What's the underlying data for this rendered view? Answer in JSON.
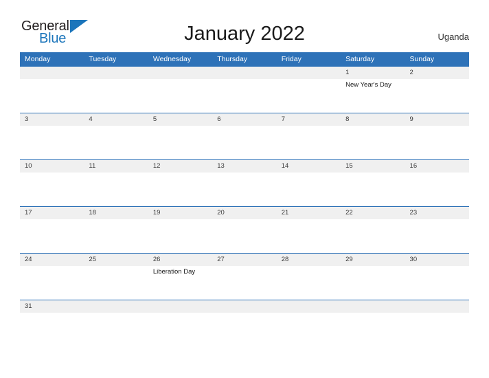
{
  "brand": {
    "word_one": "General",
    "word_two": "Blue"
  },
  "header": {
    "title": "January 2022",
    "locale": "Uganda"
  },
  "calendar": {
    "day_headers": [
      "Monday",
      "Tuesday",
      "Wednesday",
      "Thursday",
      "Friday",
      "Saturday",
      "Sunday"
    ],
    "colors": {
      "header_blue": "#2e72b8",
      "date_strip_gray": "#f0f0f0",
      "divider_blue": "#2e72b8",
      "brand_blue": "#1b75bb",
      "text_dark": "#231f20"
    },
    "weeks": [
      {
        "dates": [
          "",
          "",
          "",
          "",
          "",
          "1",
          "2"
        ],
        "events": [
          "",
          "",
          "",
          "",
          "",
          "New Year's Day",
          ""
        ]
      },
      {
        "dates": [
          "3",
          "4",
          "5",
          "6",
          "7",
          "8",
          "9"
        ],
        "events": [
          "",
          "",
          "",
          "",
          "",
          "",
          ""
        ]
      },
      {
        "dates": [
          "10",
          "11",
          "12",
          "13",
          "14",
          "15",
          "16"
        ],
        "events": [
          "",
          "",
          "",
          "",
          "",
          "",
          ""
        ]
      },
      {
        "dates": [
          "17",
          "18",
          "19",
          "20",
          "21",
          "22",
          "23"
        ],
        "events": [
          "",
          "",
          "",
          "",
          "",
          "",
          ""
        ]
      },
      {
        "dates": [
          "24",
          "25",
          "26",
          "27",
          "28",
          "29",
          "30"
        ],
        "events": [
          "",
          "",
          "Liberation Day",
          "",
          "",
          "",
          ""
        ]
      },
      {
        "dates": [
          "31",
          "",
          "",
          "",
          "",
          "",
          ""
        ],
        "events": [
          "",
          "",
          "",
          "",
          "",
          "",
          ""
        ]
      }
    ]
  }
}
